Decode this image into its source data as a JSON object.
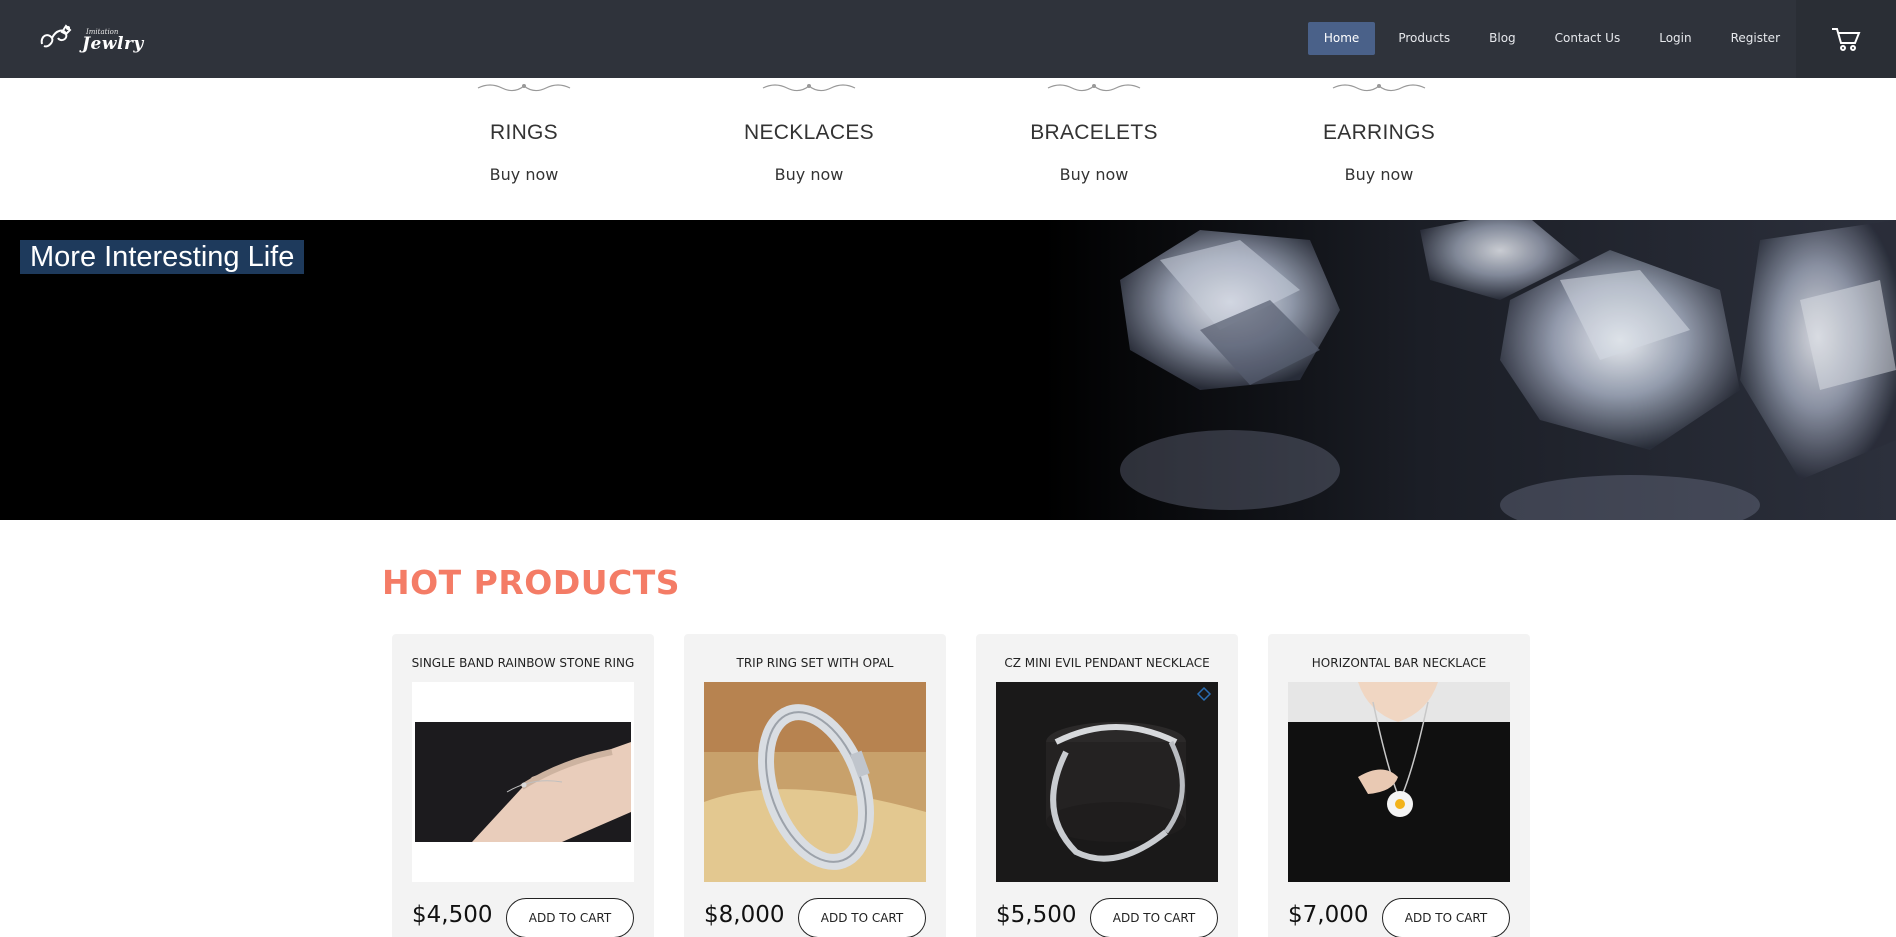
{
  "brand": {
    "logo_small": "Imitation",
    "logo_big": "Jewlry"
  },
  "nav": {
    "items": [
      {
        "label": "Home",
        "active": true
      },
      {
        "label": "Products",
        "active": false
      },
      {
        "label": "Blog",
        "active": false
      },
      {
        "label": "Contact Us",
        "active": false
      },
      {
        "label": "Login",
        "active": false
      },
      {
        "label": "Register",
        "active": false
      }
    ],
    "cart_icon": "cart-icon"
  },
  "categories": [
    {
      "title": "RINGS",
      "cta": "Buy now"
    },
    {
      "title": "NECKLACES",
      "cta": "Buy now"
    },
    {
      "title": "BRACELETS",
      "cta": "Buy now"
    },
    {
      "title": "EARRINGS",
      "cta": "Buy now"
    }
  ],
  "banner": {
    "title": "More Interesting Life"
  },
  "hot_products": {
    "title": "HOT PRODUCTS",
    "items": [
      {
        "name": "SINGLE BAND RAINBOW STONE RING",
        "price": "$4,500",
        "cta": "ADD TO CART"
      },
      {
        "name": "TRIP RING SET WITH OPAL",
        "price": "$8,000",
        "cta": "ADD TO CART"
      },
      {
        "name": "CZ MINI EVIL PENDANT NECKLACE",
        "price": "$5,500",
        "cta": "ADD TO CART"
      },
      {
        "name": "HORIZONTAL BAR NECKLACE",
        "price": "$7,000",
        "cta": "ADD TO CART"
      }
    ]
  },
  "colors": {
    "navbar": "#2f333b",
    "nav_active": "#4a6189",
    "accent": "#f47c66",
    "banner_title_bg": "#1e3a5c"
  }
}
